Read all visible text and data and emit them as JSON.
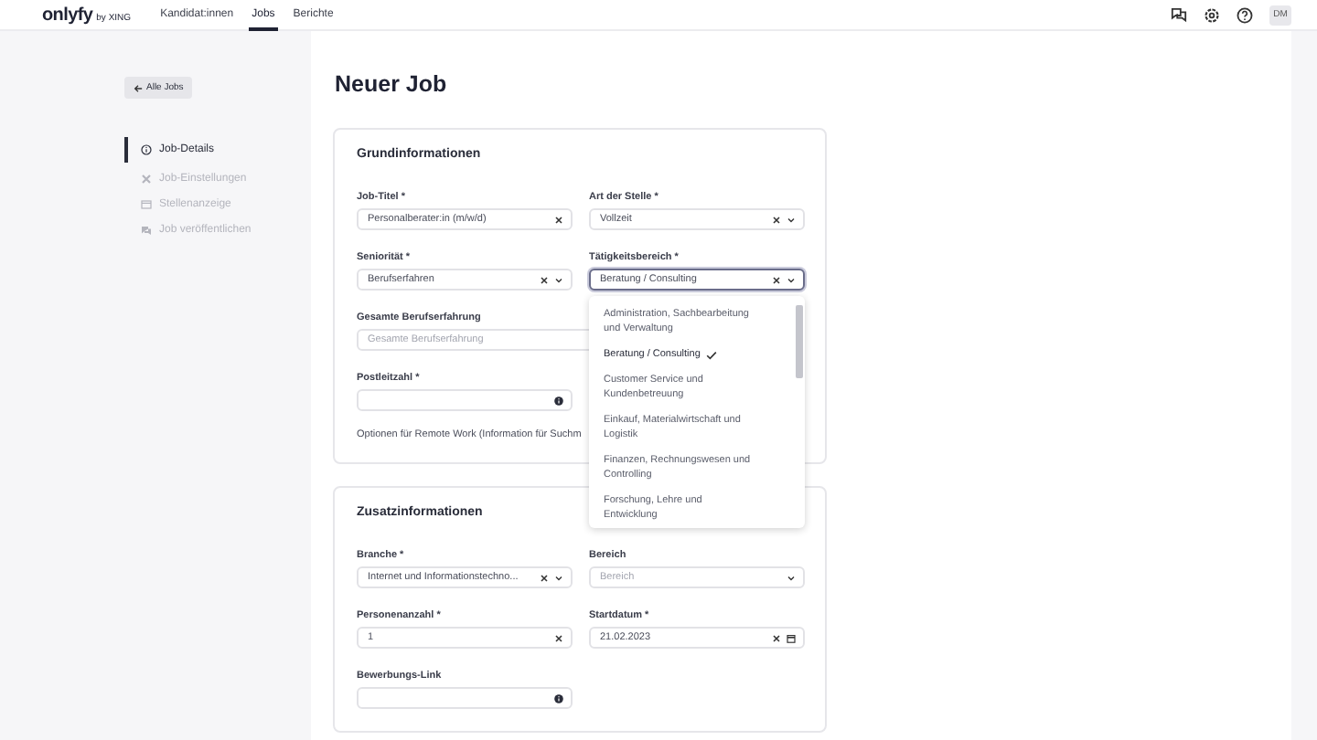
{
  "header": {
    "logo": "onlyfy",
    "logo_sub": "by XING",
    "nav": [
      {
        "label": "Kandidat:innen",
        "selected": false
      },
      {
        "label": "Jobs",
        "selected": true
      },
      {
        "label": "Berichte",
        "selected": false
      }
    ],
    "avatar": "DM"
  },
  "sidebar": {
    "back_button": "Alle Jobs",
    "steps": [
      {
        "label": "Job-Details",
        "selected": true
      },
      {
        "label": "Job-Einstellungen",
        "selected": false
      },
      {
        "label": "Stellenanzeige",
        "selected": false
      },
      {
        "label": "Job veröffentlichen",
        "selected": false
      }
    ]
  },
  "page_title": "Neuer Job",
  "sections": [
    {
      "title": "Grundinformationen",
      "fields": [
        {
          "label": "Job-Titel *",
          "kind": "text",
          "value": "Personalberater:in (m/w/d)",
          "clearable": true
        },
        {
          "label": "Art der Stelle *",
          "kind": "select",
          "value": "Vollzeit",
          "clearable": true
        },
        {
          "label": "Seniorität *",
          "kind": "select",
          "value": "Berufserfahren",
          "clearable": true
        },
        {
          "label": "Tätigkeitsbereich *",
          "kind": "select",
          "value": "Beratung / Consulting",
          "clearable": true,
          "focused": true,
          "options": [
            {
              "label": "Administration, Sachbearbeitung und Verwaltung",
              "selected": false
            },
            {
              "label": "Beratung / Consulting",
              "selected": true
            },
            {
              "label": "Customer Service und Kundenbetreuung",
              "selected": false
            },
            {
              "label": "Einkauf, Materialwirtschaft und Logistik",
              "selected": false
            },
            {
              "label": "Finanzen, Rechnungswesen und Controlling",
              "selected": false
            },
            {
              "label": "Forschung, Lehre und Entwicklung",
              "selected": false
            }
          ]
        },
        {
          "label": "Gesamte Berufserfahrung",
          "kind": "text",
          "placeholder": "Gesamte Berufserfahrung",
          "wide": true
        },
        {
          "label": "Postleitzahl *",
          "kind": "text",
          "info": true
        }
      ],
      "note": "Optionen für Remote Work (Information für Suchm"
    },
    {
      "title": "Zusatzinformationen",
      "fields": [
        {
          "label": "Branche *",
          "kind": "select",
          "value": "Internet und Informationstechno...",
          "clearable": true
        },
        {
          "label": "Bereich",
          "kind": "select",
          "placeholder": "Bereich"
        },
        {
          "label": "Personenanzahl *",
          "kind": "text",
          "value": "1",
          "clearable": true
        },
        {
          "label": "Startdatum *",
          "kind": "date",
          "value": "21.02.2023",
          "clearable": true
        },
        {
          "label": "Bewerbungs-Link",
          "kind": "text",
          "info": true
        }
      ]
    }
  ]
}
